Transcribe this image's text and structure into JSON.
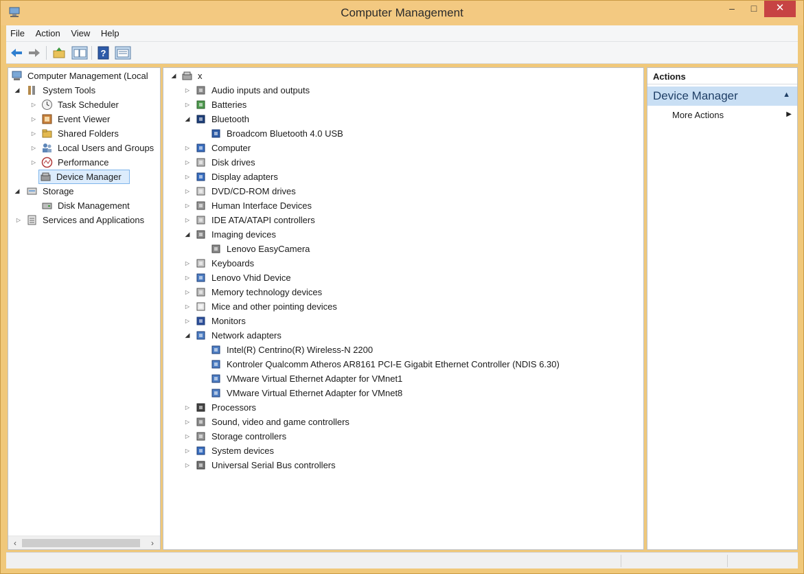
{
  "window": {
    "title": "Computer Management",
    "minimize": "–",
    "maximize": "□",
    "close": "✕"
  },
  "menu": [
    "File",
    "Action",
    "View",
    "Help"
  ],
  "toolbar": {
    "buttons": [
      "back-icon",
      "forward-icon",
      "up-folder-icon",
      "show-hide-tree-icon",
      "help-icon",
      "properties-icon"
    ]
  },
  "left_tree": {
    "root": "Computer Management (Local",
    "system_tools": "System Tools",
    "task_scheduler": "Task Scheduler",
    "event_viewer": "Event Viewer",
    "shared_folders": "Shared Folders",
    "local_users": "Local Users and Groups",
    "performance": "Performance",
    "device_manager": "Device Manager",
    "storage": "Storage",
    "disk_management": "Disk Management",
    "services": "Services and Applications"
  },
  "device_tree": {
    "root": "x",
    "items": [
      {
        "label": "Audio inputs and outputs",
        "level": 1,
        "expand": "closed",
        "icon": "speaker-icon"
      },
      {
        "label": "Batteries",
        "level": 1,
        "expand": "closed",
        "icon": "battery-icon"
      },
      {
        "label": "Bluetooth",
        "level": 1,
        "expand": "open",
        "icon": "bluetooth-icon"
      },
      {
        "label": "Broadcom Bluetooth 4.0 USB",
        "level": 2,
        "expand": "none",
        "icon": "bluetooth-device-icon"
      },
      {
        "label": "Computer",
        "level": 1,
        "expand": "closed",
        "icon": "computer-icon"
      },
      {
        "label": "Disk drives",
        "level": 1,
        "expand": "closed",
        "icon": "disk-drive-icon"
      },
      {
        "label": "Display adapters",
        "level": 1,
        "expand": "closed",
        "icon": "display-adapter-icon"
      },
      {
        "label": "DVD/CD-ROM drives",
        "level": 1,
        "expand": "closed",
        "icon": "dvd-drive-icon"
      },
      {
        "label": "Human Interface Devices",
        "level": 1,
        "expand": "closed",
        "icon": "hid-icon"
      },
      {
        "label": "IDE ATA/ATAPI controllers",
        "level": 1,
        "expand": "closed",
        "icon": "ide-controller-icon"
      },
      {
        "label": "Imaging devices",
        "level": 1,
        "expand": "open",
        "icon": "camera-icon"
      },
      {
        "label": "Lenovo EasyCamera",
        "level": 2,
        "expand": "none",
        "icon": "webcam-icon"
      },
      {
        "label": "Keyboards",
        "level": 1,
        "expand": "closed",
        "icon": "keyboard-icon"
      },
      {
        "label": "Lenovo Vhid Device",
        "level": 1,
        "expand": "closed",
        "icon": "network-device-icon"
      },
      {
        "label": "Memory technology devices",
        "level": 1,
        "expand": "closed",
        "icon": "memory-device-icon"
      },
      {
        "label": "Mice and other pointing devices",
        "level": 1,
        "expand": "closed",
        "icon": "mouse-icon"
      },
      {
        "label": "Monitors",
        "level": 1,
        "expand": "closed",
        "icon": "monitor-icon"
      },
      {
        "label": "Network adapters",
        "level": 1,
        "expand": "open",
        "icon": "network-adapter-icon"
      },
      {
        "label": "Intel(R) Centrino(R) Wireless-N 2200",
        "level": 2,
        "expand": "none",
        "icon": "network-adapter-icon"
      },
      {
        "label": "Kontroler Qualcomm Atheros AR8161 PCI-E Gigabit Ethernet Controller (NDIS 6.30)",
        "level": 2,
        "expand": "none",
        "icon": "network-adapter-icon"
      },
      {
        "label": "VMware Virtual Ethernet Adapter for VMnet1",
        "level": 2,
        "expand": "none",
        "icon": "network-adapter-icon"
      },
      {
        "label": "VMware Virtual Ethernet Adapter for VMnet8",
        "level": 2,
        "expand": "none",
        "icon": "network-adapter-icon"
      },
      {
        "label": "Processors",
        "level": 1,
        "expand": "closed",
        "icon": "processor-icon"
      },
      {
        "label": "Sound, video and game controllers",
        "level": 1,
        "expand": "closed",
        "icon": "speaker-icon"
      },
      {
        "label": "Storage controllers",
        "level": 1,
        "expand": "closed",
        "icon": "storage-controller-icon"
      },
      {
        "label": "System devices",
        "level": 1,
        "expand": "closed",
        "icon": "system-device-icon"
      },
      {
        "label": "Universal Serial Bus controllers",
        "level": 1,
        "expand": "closed",
        "icon": "usb-icon"
      }
    ]
  },
  "actions": {
    "header": "Actions",
    "section": "Device Manager",
    "more": "More Actions"
  },
  "colors": {
    "titlebar": "#f3c981",
    "selection": "#dcecfc",
    "actions_section": "#c9dff4",
    "close_button": "#c74343"
  }
}
